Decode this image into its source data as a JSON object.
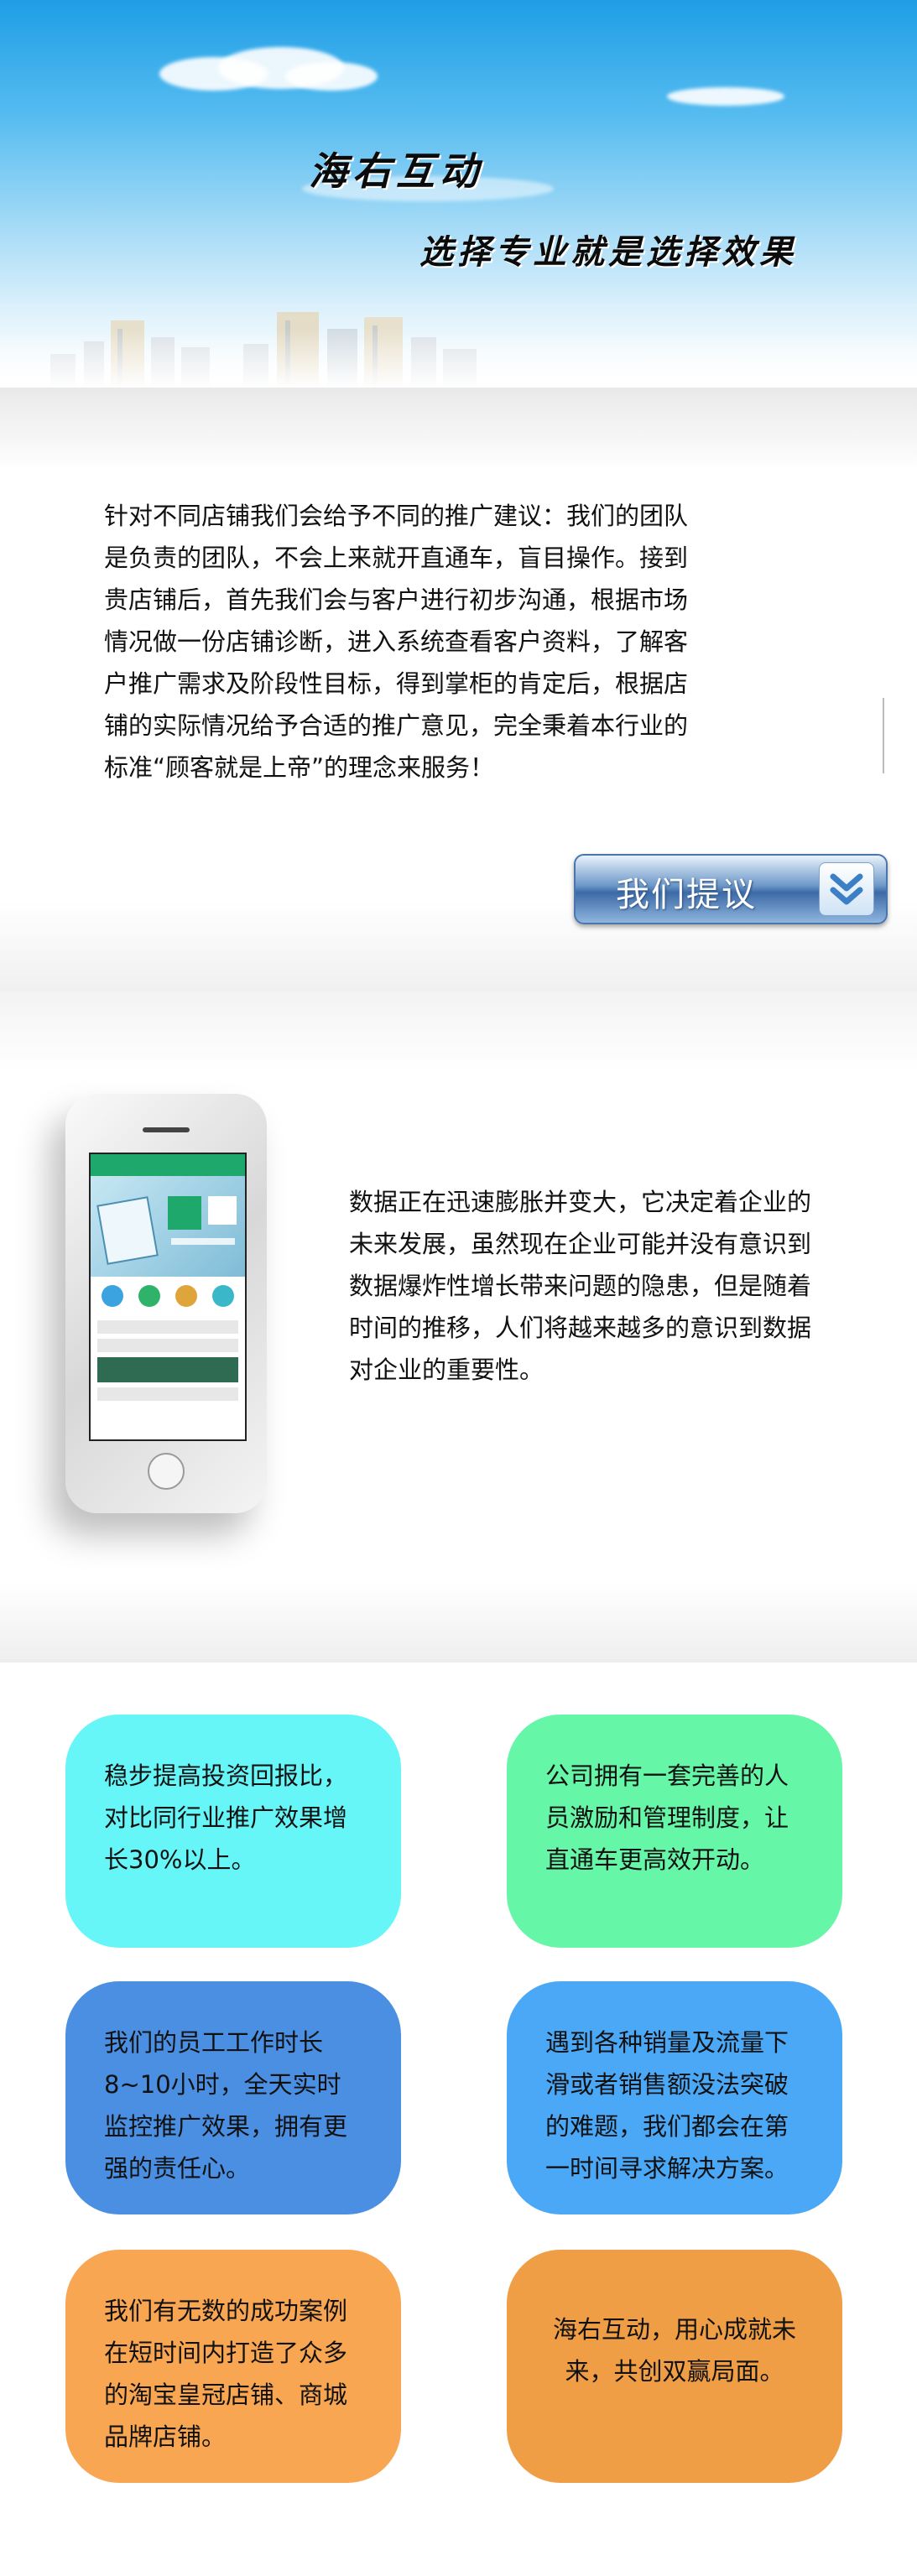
{
  "hero": {
    "title": "海右互动",
    "slogan": "选择专业就是选择效果"
  },
  "intro": {
    "text": "针对不同店铺我们会给予不同的推广建议：我们的团队是负责的团队，不会上来就开直通车，盲目操作。接到贵店铺后，首先我们会与客户进行初步沟通，根据市场情况做一份店铺诊断，进入系统查看客户资料，了解客户推广需求及阶段性目标，得到掌柜的肯定后，根据店铺的实际情况给予合适的推广意见，完全秉着本行业的标准“顾客就是上帝”的理念来服务！",
    "button_label": "我们提议"
  },
  "data_section": {
    "text": "数据正在迅速膨胀并变大，它决定着企业的未来发展，虽然现在企业可能并没有意识到数据爆炸性增长带来问题的隐患，但是随着时间的推移，人们将越来越多的意识到数据对企业的重要性。"
  },
  "cards": [
    {
      "text": "稳步提高投资回报比，对比同行业推广效果增长30%以上。",
      "color": "#66f6f8"
    },
    {
      "text": "公司拥有一套完善的人员激励和管理制度，让直通车更高效开动。",
      "color": "#66f6a8"
    },
    {
      "text": "我们的员工工作时长8~10小时，全天实时监控推广效果，拥有更强的责任心。",
      "color": "#4a8fe2"
    },
    {
      "text": "遇到各种销量及流量下滑或者销售额没法突破的难题，我们都会在第一时间寻求解决方案。",
      "color": "#4aa8f6"
    },
    {
      "text": "我们有无数的成功案例在短时间内打造了众多的淘宝皇冠店铺、商城品牌店铺。",
      "color": "#f8a652"
    },
    {
      "text": "海右互动，用心成就未来，共创双赢局面。",
      "color": "#ef9e46"
    }
  ]
}
